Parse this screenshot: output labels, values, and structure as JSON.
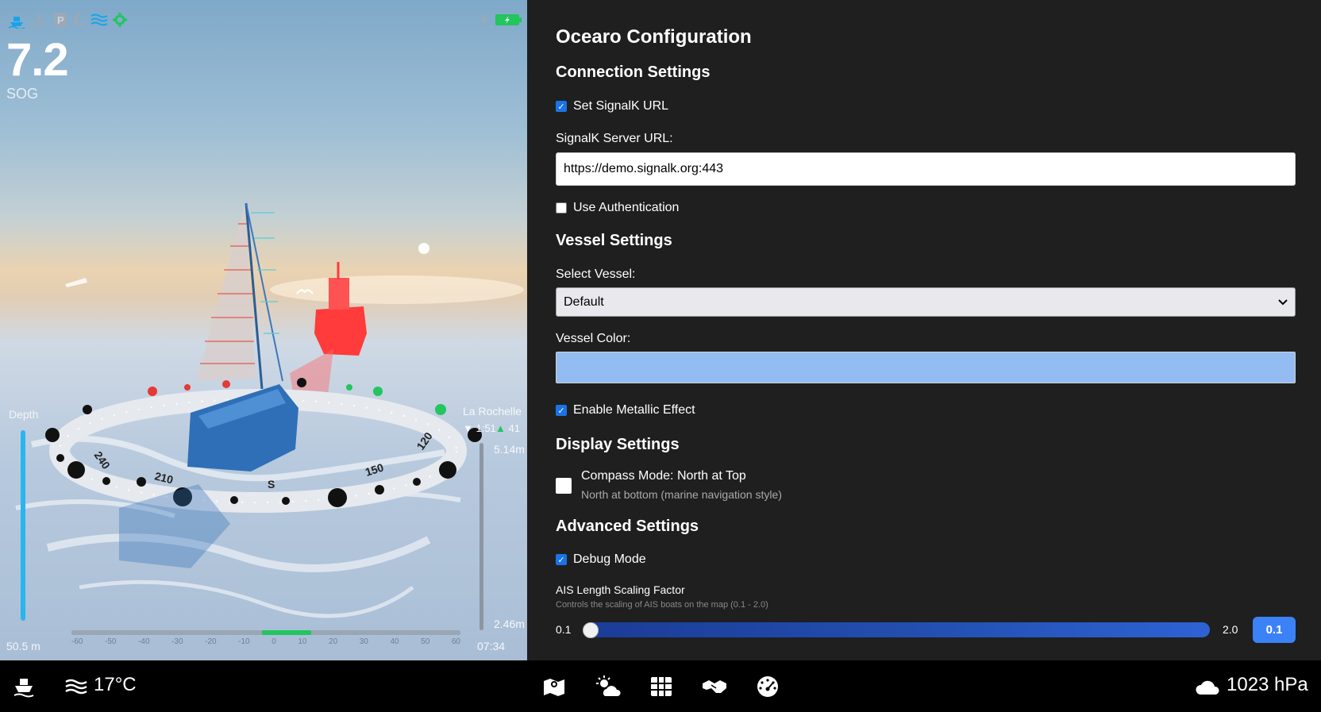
{
  "scene": {
    "status_icons": [
      {
        "name": "ship-icon",
        "color": "#1aa3e8"
      },
      {
        "name": "anchor-icon",
        "color": "#9aa8b7"
      },
      {
        "name": "parking-icon",
        "color": "#9aa8b7"
      },
      {
        "name": "moon-icon",
        "color": "#9aa8b7"
      },
      {
        "name": "waves-icon",
        "color": "#1aa3e8"
      },
      {
        "name": "gear-icon",
        "color": "#22c55e"
      },
      {
        "name": "bolt-icon",
        "color": "#9aa8b7"
      },
      {
        "name": "battery-icon",
        "color": "#22c55e"
      }
    ],
    "sog": {
      "value": "7.2",
      "label": "SOG"
    },
    "depth": {
      "label": "Depth",
      "value": "50.5 m"
    },
    "compass_labels": [
      "210",
      "S",
      "150",
      "120",
      "240"
    ],
    "tide": {
      "location": "La Rochelle",
      "low_time": "1:51",
      "high_time": "41",
      "high_height": "5.14m",
      "low_height": "2.46m",
      "current_time": "07:34"
    },
    "heel_scale_ticks": [
      "-60",
      "-50",
      "-40",
      "-30",
      "-20",
      "-10",
      "0",
      "10",
      "20",
      "30",
      "40",
      "50",
      "60"
    ]
  },
  "config": {
    "title": "Ocearo Configuration",
    "connection": {
      "heading": "Connection Settings",
      "set_signalk_url_label": "Set SignalK URL",
      "set_signalk_url_checked": true,
      "server_url_label": "SignalK Server URL:",
      "server_url_value": "https://demo.signalk.org:443",
      "use_auth_label": "Use Authentication",
      "use_auth_checked": false
    },
    "vessel": {
      "heading": "Vessel Settings",
      "select_label": "Select Vessel:",
      "selected_vessel": "Default",
      "color_label": "Vessel Color:",
      "color_value": "#93bdf2",
      "metallic_label": "Enable Metallic Effect",
      "metallic_checked": true
    },
    "display": {
      "heading": "Display Settings",
      "compass_mode_title": "Compass Mode: North at Top",
      "compass_mode_desc": "North at bottom (marine navigation style)",
      "compass_mode_checked": false
    },
    "advanced": {
      "heading": "Advanced Settings",
      "debug_label": "Debug Mode",
      "debug_checked": true,
      "ais_title": "AIS Length Scaling Factor",
      "ais_desc": "Controls the scaling of AIS boats on the map (0.1 - 2.0)",
      "ais_min": "0.1",
      "ais_max": "2.0",
      "ais_value": "0.1"
    }
  },
  "bottom_bar": {
    "water_temp": "17°C",
    "pressure": "1023 hPa",
    "nav_icons": [
      "map-icon",
      "weather-icon",
      "grid-icon",
      "handshake-icon",
      "gauge-icon"
    ]
  }
}
